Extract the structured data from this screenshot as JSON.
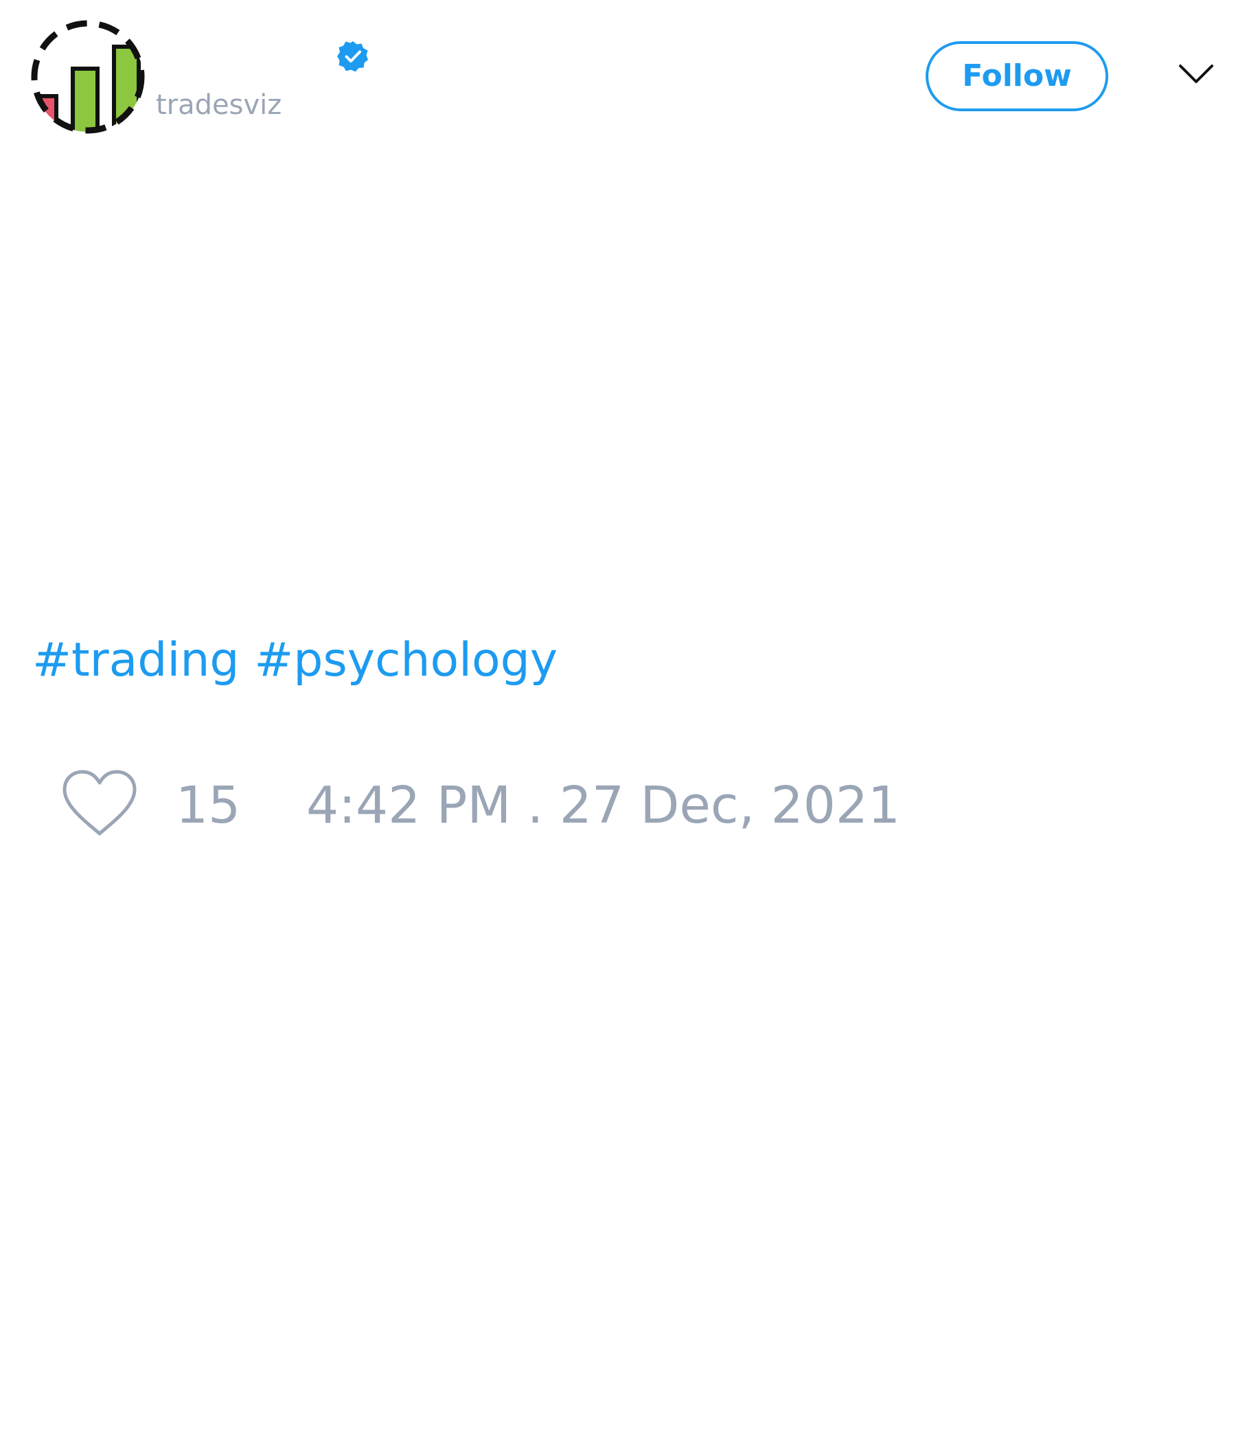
{
  "header": {
    "handle": "tradesviz",
    "follow_label": "Follow",
    "verified": true,
    "avatar_icon": "bar-chart-logo",
    "verified_icon": "verified-badge-icon",
    "menu_icon": "chevron-down-icon"
  },
  "tweet": {
    "hashtags": [
      "#trading",
      "#psychology"
    ]
  },
  "footer": {
    "like_icon": "heart-icon",
    "like_count": "15",
    "timestamp": "4:42 PM . 27 Dec, 2021"
  },
  "colors": {
    "accent": "#1d9bf0",
    "muted_text": "#9aa5b5",
    "logo_green": "#8dc63f",
    "logo_red": "#e8536b",
    "background": "#ffffff"
  }
}
